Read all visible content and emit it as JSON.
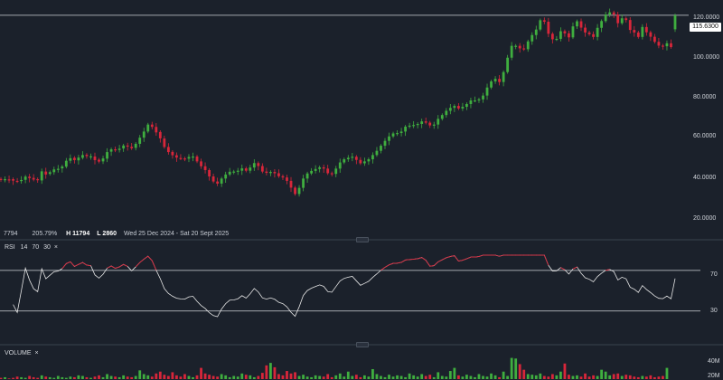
{
  "summary": {
    "first": "7794",
    "change": "205.79%",
    "high_label": "H",
    "high": "11794",
    "low_label": "L",
    "low": "2860",
    "range": "Wed 25 Dec 2024 - Sat 20 Sept 2025"
  },
  "price_axis": {
    "ticks": [
      "120.0000",
      "100.0000",
      "80.0000",
      "60.0000",
      "40.0000",
      "20.0000"
    ],
    "current": "115.6300"
  },
  "rsi": {
    "title": "RSI",
    "period": "14",
    "upper": "70",
    "lower": "30",
    "close": "×",
    "ticks": [
      "70",
      "30"
    ]
  },
  "volume": {
    "title": "VOLUME",
    "close": "×",
    "ticks": [
      "40M",
      "20M"
    ]
  },
  "colors": {
    "background": "#1b212b",
    "up": "#3fae3f",
    "down": "#d8263a",
    "rsi_line": "#e6e6e6",
    "rsi_over": "#d8263a",
    "guide": "#cfd3d8",
    "separator": "#3a424e"
  },
  "chart_data": {
    "type": "candlestick",
    "price_ylim": [
      10,
      122
    ],
    "rsi_ylim": [
      20,
      85
    ],
    "volume_ylim": [
      0,
      45
    ],
    "closes": [
      37.8,
      38.2,
      38.0,
      37.5,
      37.2,
      37.8,
      39.4,
      38.7,
      38.0,
      37.7,
      41.9,
      40.4,
      41.5,
      42.8,
      43.1,
      44.2,
      46.9,
      48.1,
      47.2,
      48.4,
      49.6,
      49.1,
      49.0,
      47.2,
      46.5,
      48.0,
      51.0,
      52.3,
      51.8,
      52.6,
      54.1,
      53.7,
      52.8,
      54.9,
      57.8,
      60.7,
      64.0,
      62.9,
      60.3,
      57.5,
      53.4,
      51.0,
      49.5,
      48.4,
      48.0,
      47.9,
      48.7,
      48.9,
      46.6,
      44.3,
      42.5,
      39.5,
      37.1,
      36.1,
      38.5,
      40.4,
      41.7,
      41.8,
      42.2,
      43.3,
      42.2,
      43.7,
      45.8,
      44.4,
      41.8,
      41.2,
      41.6,
      41.0,
      39.6,
      39.0,
      37.4,
      34.2,
      31.2,
      34.1,
      38.5,
      40.9,
      42.1,
      43.0,
      43.8,
      43.2,
      41.0,
      40.7,
      43.2,
      46.1,
      47.6,
      48.3,
      48.8,
      47.3,
      45.7,
      46.6,
      47.6,
      49.6,
      51.6,
      54.0,
      56.3,
      58.4,
      59.8,
      60.0,
      60.7,
      63.0,
      63.5,
      63.8,
      64.3,
      65.5,
      64.9,
      63.6,
      64.0,
      66.7,
      68.5,
      70.5,
      71.9,
      72.8,
      71.6,
      72.4,
      73.7,
      75.4,
      75.4,
      75.9,
      77.7,
      81.5,
      84.4,
      85.6,
      84.1,
      88.8,
      95.6,
      101.2,
      101.2,
      100.0,
      99.6,
      103.3,
      106.3,
      108.9,
      113.3,
      112.6,
      106.9,
      104.3,
      104.5,
      108.1,
      107.1,
      105.2,
      110.4,
      112.8,
      109.8,
      107.5,
      106.7,
      105.4,
      109.7,
      112.9,
      116.0,
      117.0,
      116.0,
      111.9,
      114.2,
      113.4,
      108.7,
      107.5,
      105.4,
      110.1,
      107.6,
      105.5,
      103.1,
      101.3,
      101.0,
      102.4,
      100.6,
      115.6
    ],
    "opens": [
      38.3,
      37.9,
      38.1,
      38.2,
      37.4,
      37.3,
      37.9,
      39.4,
      38.8,
      38.2,
      37.6,
      41.8,
      40.7,
      41.5,
      42.9,
      43.3,
      44.1,
      46.9,
      48.3,
      47.1,
      48.3,
      49.7,
      49.0,
      48.9,
      47.4,
      46.6,
      47.9,
      51.2,
      52.3,
      52.0,
      52.7,
      54.1,
      53.5,
      53.0,
      54.9,
      57.8,
      60.7,
      64.0,
      62.9,
      60.5,
      57.4,
      53.4,
      51.1,
      49.5,
      48.2,
      48.0,
      47.9,
      48.7,
      48.9,
      46.6,
      44.3,
      42.5,
      39.5,
      37.1,
      36.1,
      38.5,
      40.4,
      41.7,
      41.8,
      42.2,
      43.3,
      42.2,
      43.7,
      45.8,
      44.4,
      41.8,
      41.2,
      41.6,
      41.0,
      39.6,
      39.0,
      37.4,
      34.2,
      31.2,
      34.1,
      38.5,
      40.9,
      42.1,
      43.0,
      43.8,
      43.2,
      41.0,
      40.7,
      43.2,
      46.1,
      47.6,
      48.3,
      48.8,
      47.3,
      45.7,
      46.6,
      47.6,
      49.6,
      51.6,
      54.0,
      56.3,
      58.4,
      59.8,
      60.0,
      60.7,
      63.0,
      63.5,
      63.8,
      64.3,
      65.5,
      64.9,
      63.6,
      64.0,
      66.7,
      68.5,
      70.5,
      71.9,
      72.8,
      71.6,
      72.4,
      73.7,
      75.4,
      75.4,
      75.9,
      77.7,
      81.5,
      84.4,
      85.6,
      84.1,
      88.8,
      95.6,
      101.2,
      101.2,
      100.0,
      99.6,
      103.3,
      106.3,
      108.9,
      113.3,
      112.6,
      106.9,
      104.3,
      104.5,
      108.1,
      107.1,
      105.2,
      110.4,
      112.8,
      109.8,
      107.5,
      106.7,
      105.4,
      109.7,
      112.9,
      116.0,
      117.0,
      116.0,
      111.9,
      114.2,
      113.4,
      108.7,
      107.5,
      105.4,
      110.1,
      107.6,
      105.5,
      103.1,
      101.3,
      101.0,
      102.4,
      109.0
    ],
    "rsi_over": 70,
    "rsi_under": 30,
    "volumes": [
      2,
      3,
      1,
      2,
      4,
      3,
      2,
      5,
      3,
      2,
      6,
      4,
      3,
      2,
      5,
      3,
      2,
      4,
      3,
      6,
      5,
      3,
      2,
      4,
      6,
      3,
      8,
      5,
      4,
      3,
      6,
      4,
      3,
      5,
      14,
      8,
      6,
      4,
      9,
      12,
      7,
      5,
      11,
      6,
      4,
      8,
      5,
      3,
      6,
      18,
      9,
      7,
      5,
      4,
      8,
      6,
      3,
      5,
      4,
      9,
      7,
      6,
      3,
      5,
      10,
      22,
      26,
      19,
      8,
      6,
      13,
      9,
      11,
      5,
      7,
      4,
      3,
      6,
      5,
      4,
      8,
      3,
      6,
      9,
      4,
      12,
      5,
      7,
      3,
      6,
      4,
      16,
      8,
      5,
      3,
      7,
      4,
      6,
      5,
      3,
      9,
      6,
      4,
      8,
      5,
      7,
      3,
      11,
      5,
      4,
      13,
      18,
      6,
      4,
      7,
      5,
      3,
      8,
      5,
      4,
      9,
      6,
      3,
      12,
      5,
      34,
      33,
      24,
      15,
      8,
      7,
      6,
      9,
      5,
      4,
      8,
      6,
      12,
      25,
      7,
      5,
      6,
      4,
      9,
      4,
      6,
      5,
      15,
      12,
      6,
      8,
      9,
      5,
      7,
      6,
      4,
      3,
      5,
      4,
      6,
      3,
      4,
      5,
      18
    ]
  }
}
